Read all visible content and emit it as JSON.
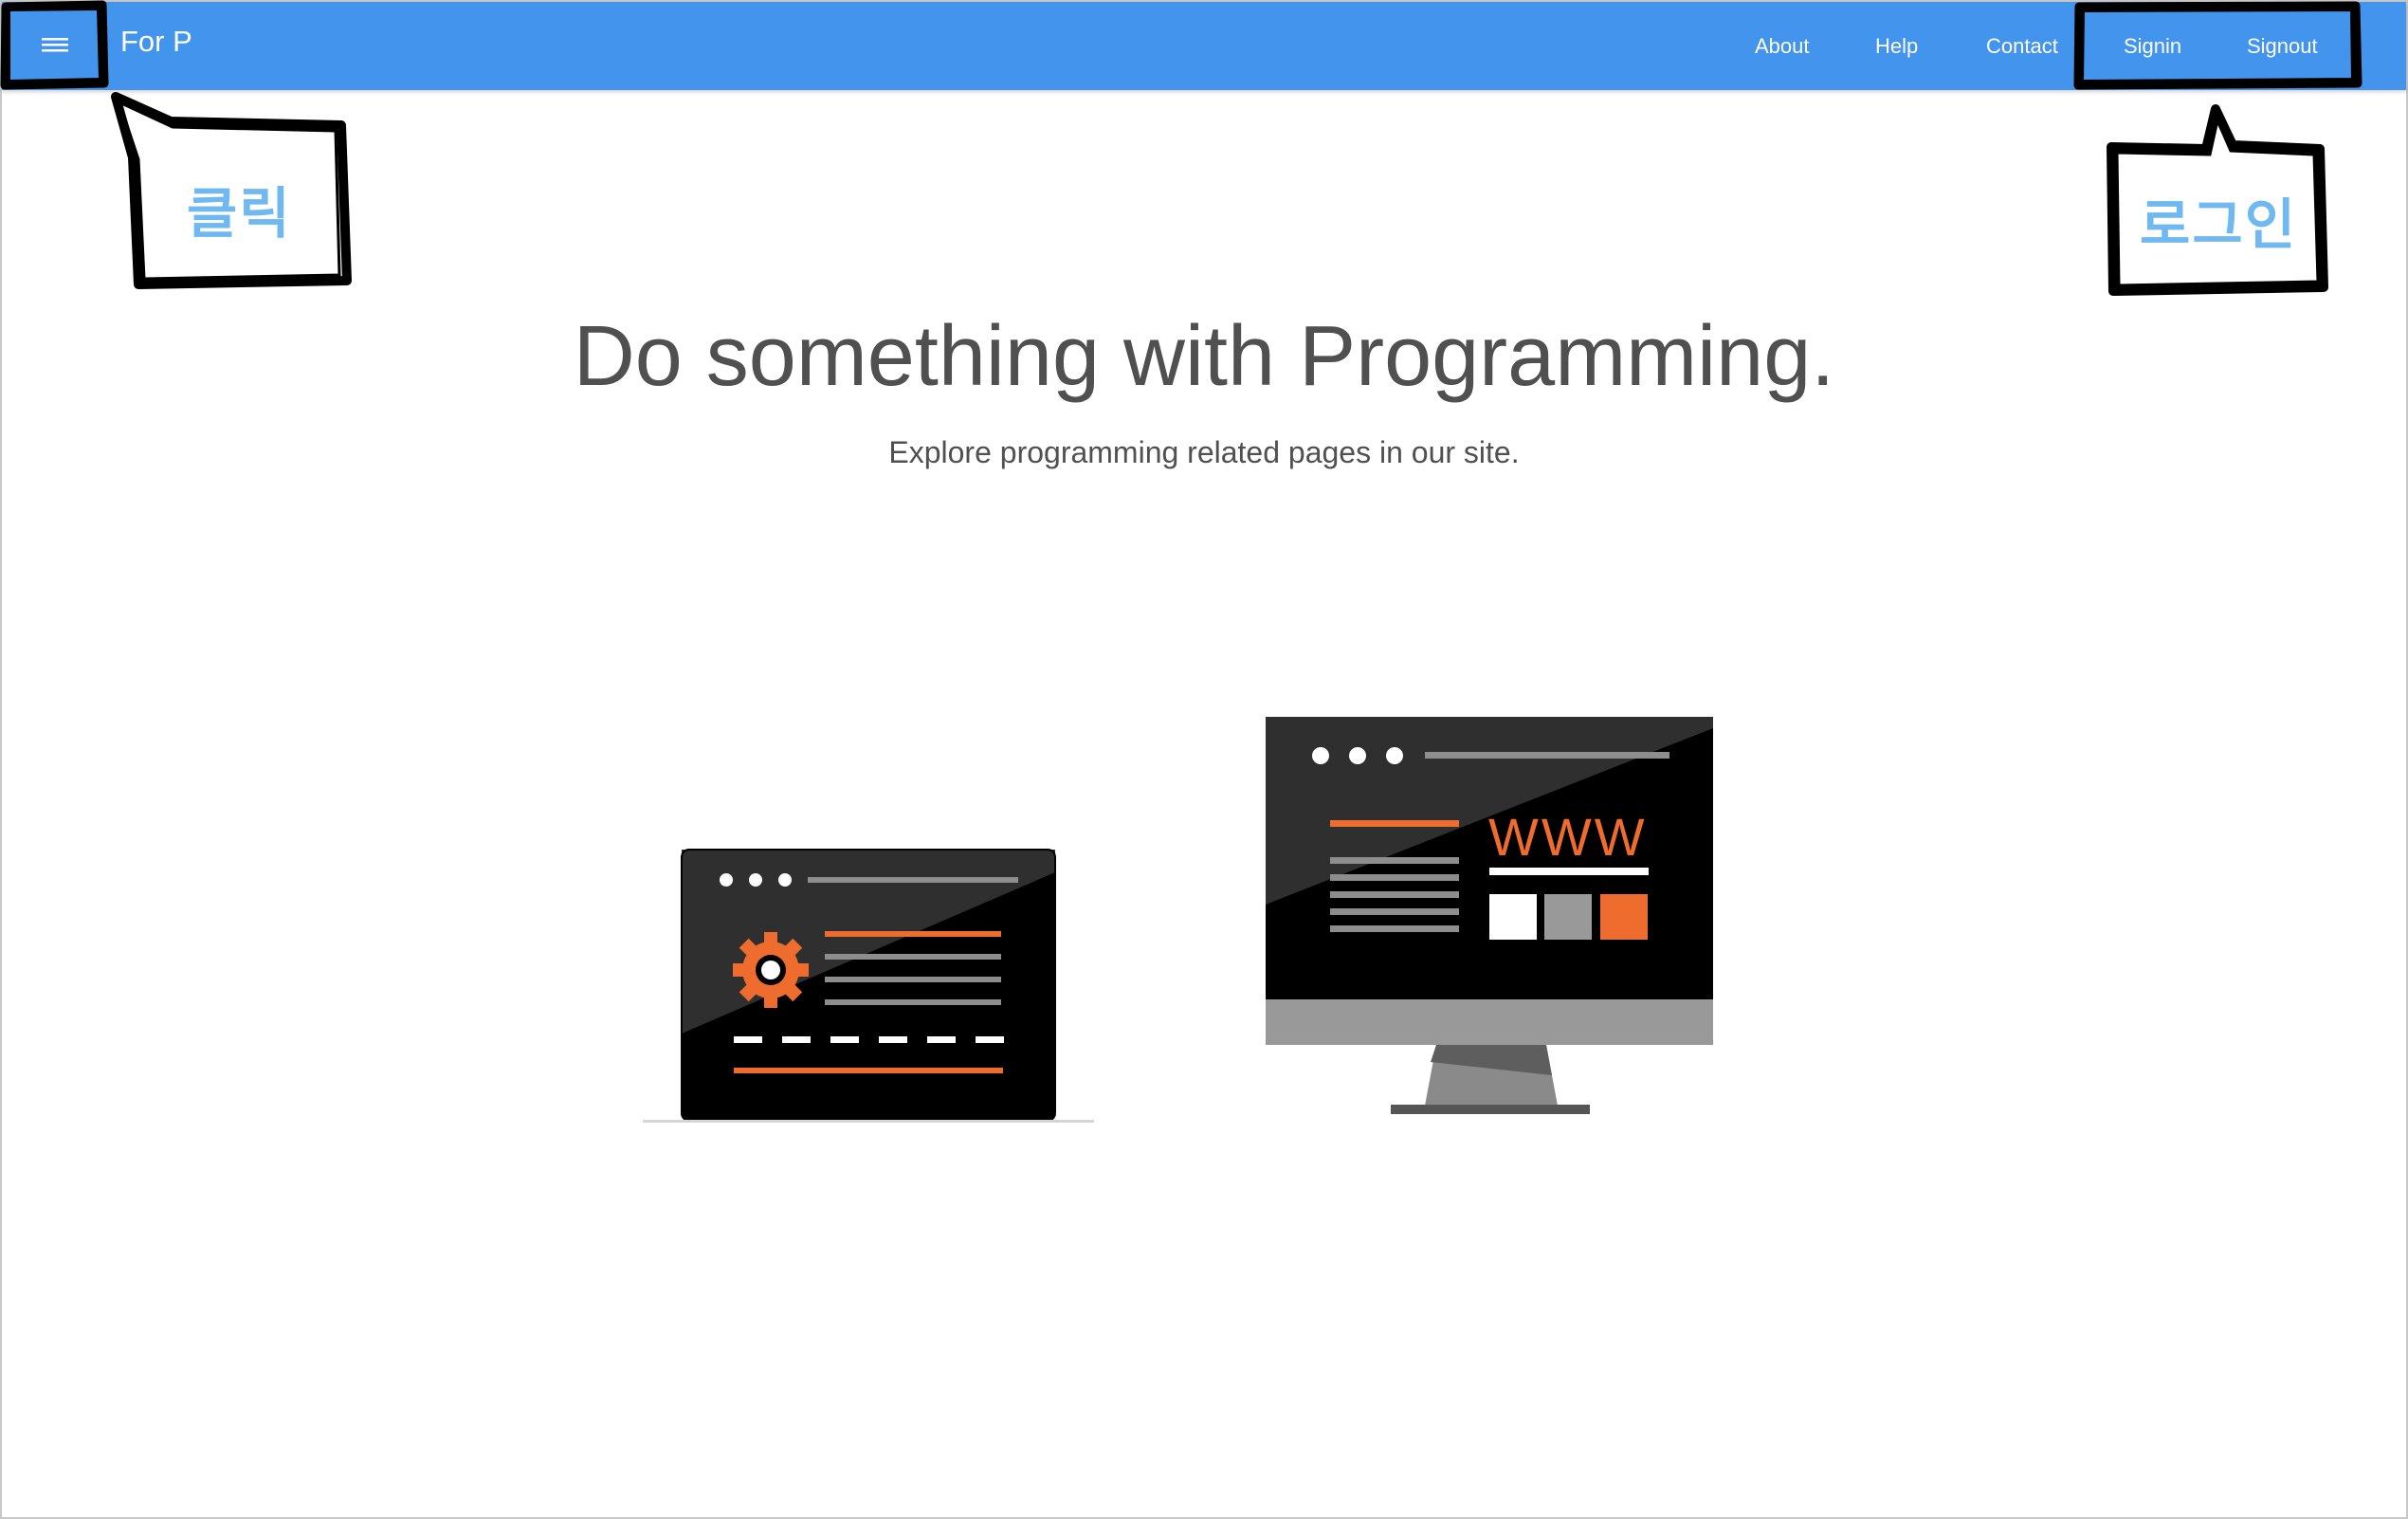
{
  "nav": {
    "brand": "For P",
    "links": [
      {
        "label": "About"
      },
      {
        "label": "Help"
      },
      {
        "label": "Contact"
      },
      {
        "label": "Signin"
      },
      {
        "label": "Signout"
      }
    ]
  },
  "annotations": {
    "menu_callout": "클릭",
    "auth_callout": "로그인"
  },
  "hero": {
    "title": "Do something with Programming.",
    "subtitle": "Explore programming related pages in our site."
  },
  "illustration": {
    "monitor_text": "WWW"
  },
  "colors": {
    "navbar": "#4294ec",
    "accent_orange": "#ee6c2e",
    "callout_text": "#6fb9f0",
    "heading_text": "#505050"
  },
  "icons": {
    "menu": "hamburger-menu-icon",
    "gear": "gear-icon"
  }
}
